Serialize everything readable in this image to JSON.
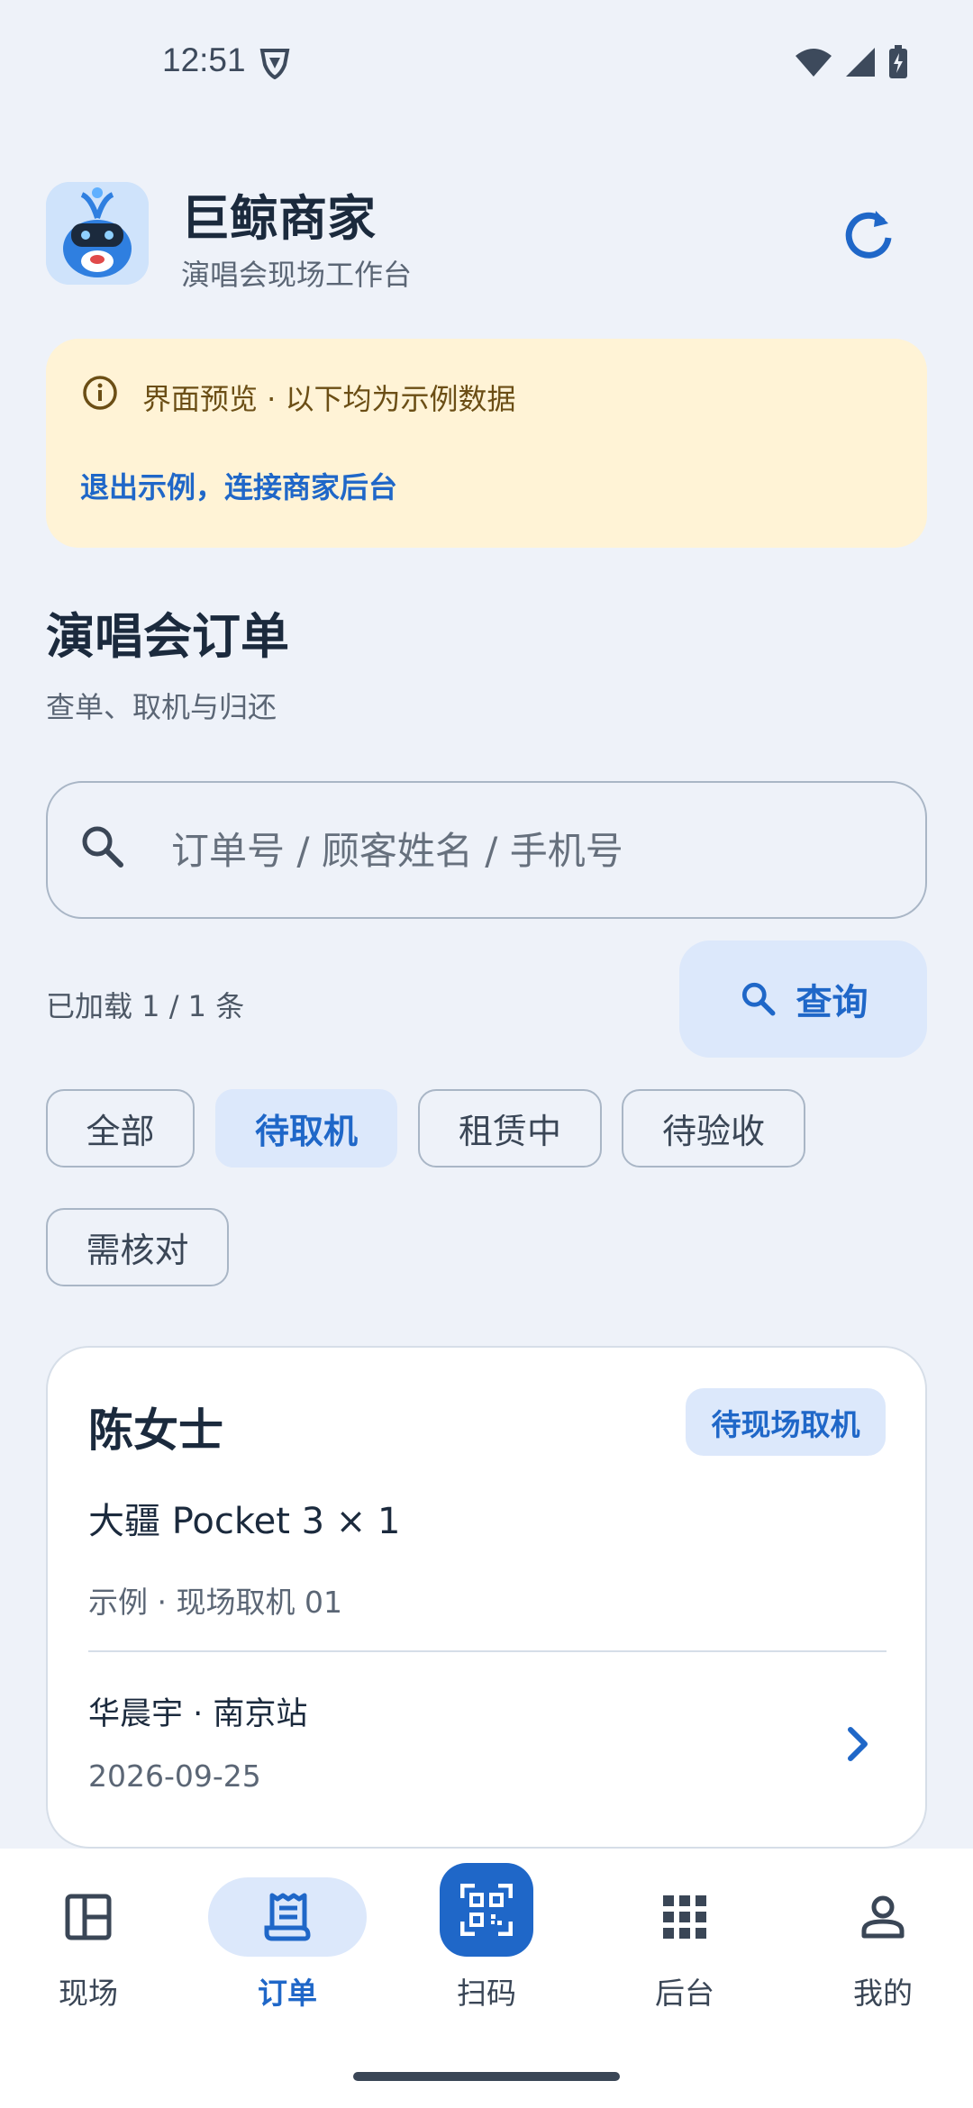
{
  "status_bar": {
    "time": "12:51"
  },
  "header": {
    "title": "巨鲸商家",
    "subtitle": "演唱会现场工作台"
  },
  "banner": {
    "text": "界面预览 · 以下均为示例数据",
    "link": "退出示例，连接商家后台"
  },
  "section": {
    "title": "演唱会订单",
    "subtitle": "查单、取机与归还"
  },
  "search": {
    "placeholder": "订单号 / 顾客姓名 / 手机号",
    "value": ""
  },
  "loaded": "已加载 1 / 1 条",
  "query_button": "查询",
  "filters": [
    "全部",
    "待取机",
    "租赁中",
    "待验收",
    "需核对"
  ],
  "active_filter": "待取机",
  "order": {
    "customer": "陈女士",
    "status": "待现场取机",
    "product": "大疆 Pocket 3 × 1",
    "note": "示例 · 现场取机 01",
    "artist_city": "华晨宇 · 南京站",
    "date": "2026-09-25"
  },
  "bottom_nav": [
    {
      "label": "现场",
      "icon": "dashboard-icon"
    },
    {
      "label": "订单",
      "icon": "receipt-icon",
      "active": true
    },
    {
      "label": "扫码",
      "icon": "qr-scan-icon"
    },
    {
      "label": "后台",
      "icon": "apps-grid-icon"
    },
    {
      "label": "我的",
      "icon": "person-icon"
    }
  ],
  "colors": {
    "accent": "#1f67c8",
    "accent_light": "#dce8fb",
    "banner_bg": "#fff3d6",
    "page_bg": "#eef2f9"
  }
}
